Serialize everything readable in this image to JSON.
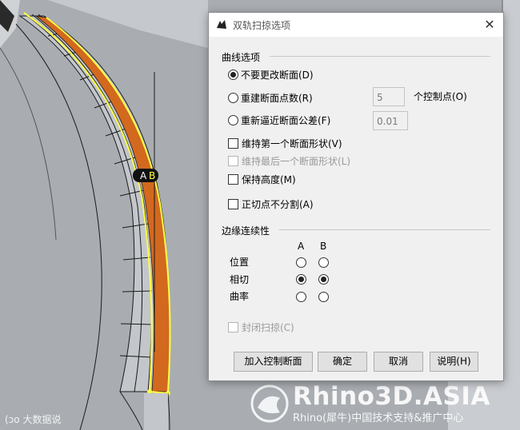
{
  "dialog": {
    "title": "双轨扫掠选项",
    "curve_options": {
      "heading": "曲线选项",
      "radio_no_change": "不要更改断面(D)",
      "radio_rebuild": "重建断面点数(R)",
      "rebuild_value": "5",
      "rebuild_suffix": "个控制点(O)",
      "radio_refit": "重新逼近断面公差(F)",
      "refit_value": "0.01",
      "check_keep_first": "维持第一个断面形状(V)",
      "check_keep_last": "维持最后一个断面形状(L)",
      "check_keep_height": "保持高度(M)",
      "check_no_split": "正切点不分割(A)"
    },
    "edge_continuity": {
      "heading": "边缘连续性",
      "col_a": "A",
      "col_b": "B",
      "row_position": "位置",
      "row_tangency": "相切",
      "row_curvature": "曲率"
    },
    "close_sweep": "封闭扫掠(C)",
    "buttons": {
      "add_section": "加入控制断面",
      "ok": "确定",
      "cancel": "取消",
      "help": "说明(H)"
    }
  },
  "viewport": {
    "rail_label_a": "A",
    "rail_label_b": "B"
  },
  "watermark": {
    "main": "Rhino3D.ASIA",
    "sub": "Rhino(犀牛)中国技术支持&推广中心",
    "corner": "大数据说"
  },
  "colors": {
    "viewport_bg": "#a9adb2",
    "surface_fill": "#c3c6ca",
    "highlight_rail": "#ffff44",
    "section_fill": "#d2691e"
  }
}
